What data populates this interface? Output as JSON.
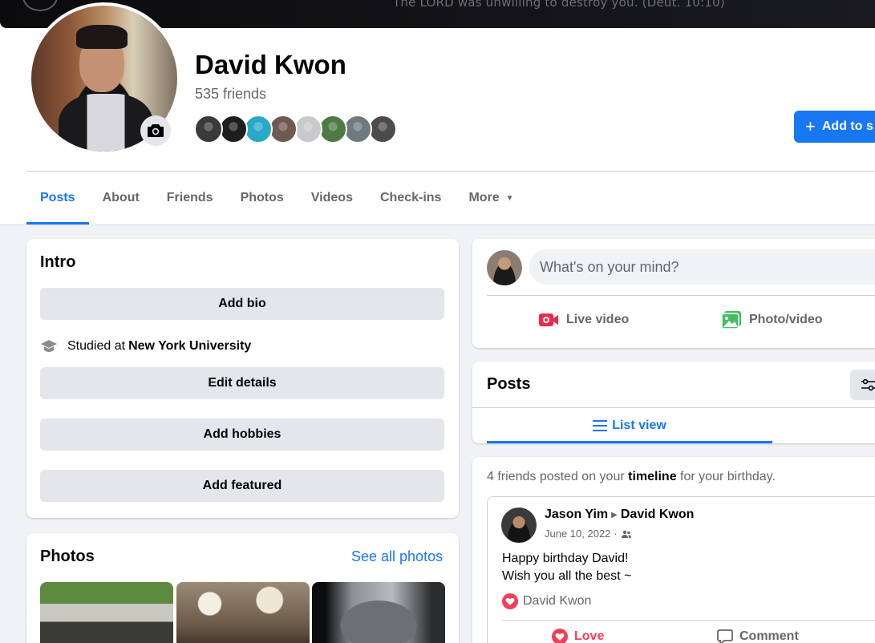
{
  "cover": {
    "quote": "The LORD was unwilling to destroy you. (Deut. 10:10)"
  },
  "profile": {
    "name": "David Kwon",
    "friend_count": "535 friends",
    "friend_avatar_colors": [
      "#3a3a3a",
      "#1e1e1e",
      "#2aa8c8",
      "#6e5a4e",
      "#c8c9cc",
      "#4e7a46",
      "#6f7a7e",
      "#4b4b4b"
    ]
  },
  "actions": {
    "add_story": "Add to s",
    "add_story_icon": "plus-icon"
  },
  "tabs": [
    {
      "label": "Posts",
      "active": true
    },
    {
      "label": "About"
    },
    {
      "label": "Friends"
    },
    {
      "label": "Photos"
    },
    {
      "label": "Videos"
    },
    {
      "label": "Check-ins"
    },
    {
      "label": "More"
    }
  ],
  "intro": {
    "title": "Intro",
    "add_bio": "Add bio",
    "studied_prefix": "Studied at",
    "school": "New York University",
    "edit_details": "Edit details",
    "add_hobbies": "Add hobbies",
    "add_featured": "Add featured"
  },
  "photos": {
    "title": "Photos",
    "see_all": "See all photos"
  },
  "composer": {
    "placeholder": "What's on your mind?",
    "live_video": "Live video",
    "photo_video": "Photo/video"
  },
  "posts_header": {
    "title": "Posts",
    "list_view": "List view"
  },
  "feed": {
    "birthday_prefix": "4 friends posted on your",
    "birthday_link": "timeline",
    "birthday_suffix": "for your birthday.",
    "post": {
      "author": "Jason Yim",
      "target": "David Kwon",
      "date": "June 10, 2022",
      "line1": "Happy birthday David!",
      "line2": "Wish you all the best ~",
      "reaction_name": "David Kwon",
      "love_label": "Love",
      "comment_label": "Comment"
    }
  },
  "colors": {
    "accent": "#1877f2",
    "love": "#f33e58",
    "live": "#f02849",
    "photo": "#45bd62"
  }
}
